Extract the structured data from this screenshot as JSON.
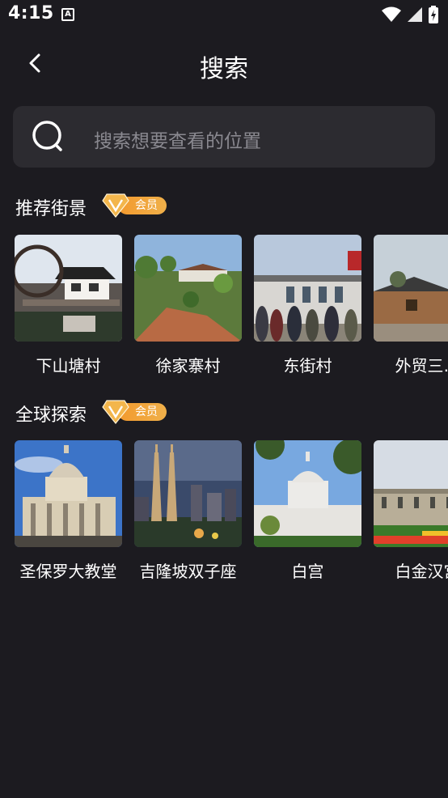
{
  "status_bar": {
    "time": "4:15",
    "notification_letter": "A"
  },
  "header": {
    "title": "搜索"
  },
  "search": {
    "placeholder": "搜索想要查看的位置"
  },
  "sections": [
    {
      "title": "推荐街景",
      "badge": "会员",
      "items": [
        {
          "label": "下山塘村"
        },
        {
          "label": "徐家寨村"
        },
        {
          "label": "东街村"
        },
        {
          "label": "外贸三…"
        }
      ]
    },
    {
      "title": "全球探索",
      "badge": "会员",
      "items": [
        {
          "label": "圣保罗大教堂"
        },
        {
          "label": "吉隆坡双子座"
        },
        {
          "label": "白宫"
        },
        {
          "label": "白金汉宫"
        }
      ]
    }
  ],
  "colors": {
    "background": "#1c1b20",
    "search_bg": "#2c2b30",
    "placeholder": "#8a8990",
    "badge_orange": "#f29a2e"
  }
}
